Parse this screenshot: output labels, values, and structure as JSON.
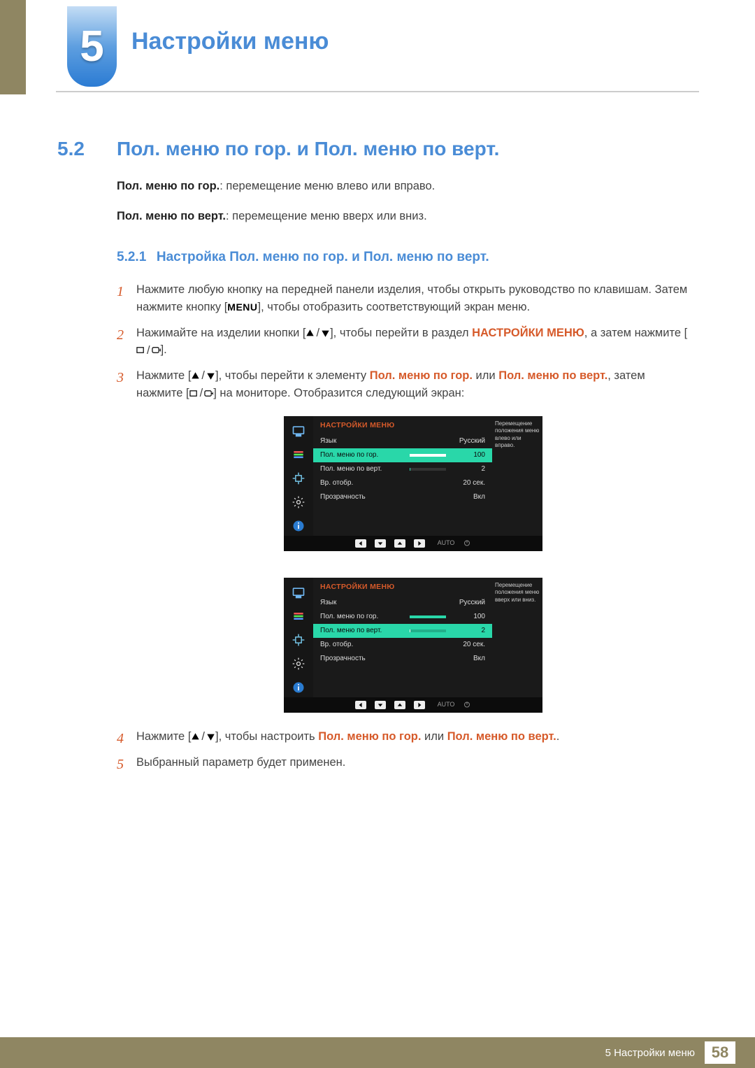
{
  "chapter": {
    "number": "5",
    "title": "Настройки меню"
  },
  "section": {
    "number": "5.2",
    "title": "Пол. меню по гор. и Пол. меню по верт."
  },
  "intro": {
    "h_bold": "Пол. меню по гор.",
    "h_rest": ": перемещение меню влево или вправо.",
    "v_bold": "Пол. меню по верт.",
    "v_rest": ": перемещение меню вверх или вниз."
  },
  "subsection": {
    "number": "5.2.1",
    "title": "Настройка Пол. меню по гор. и Пол. меню по верт."
  },
  "steps": {
    "s1a": "Нажмите любую кнопку на передней панели изделия, чтобы открыть руководство по клавишам. Затем нажмите кнопку [",
    "s1_menu": "MENU",
    "s1b": "], чтобы отобразить соответствующий экран меню.",
    "s2a": "Нажимайте на изделии кнопки [",
    "s2b": "], чтобы перейти в раздел ",
    "s2_target": "НАСТРОЙКИ МЕНЮ",
    "s2c": ", а затем нажмите [",
    "s2d": "].",
    "s3a": "Нажмите [",
    "s3b": "], чтобы перейти к элементу ",
    "s3_h": "Пол. меню по гор.",
    "s3_or": " или ",
    "s3_v": "Пол. меню по верт.",
    "s3c": ", затем нажмите [",
    "s3d": "] на мониторе. Отобразится следующий экран:",
    "s4a": "Нажмите [",
    "s4b": "], чтобы настроить ",
    "s4_h": "Пол. меню по гор.",
    "s4_or": " или ",
    "s4_v": "Пол. меню по верт.",
    "s4c": ".",
    "s5": "Выбранный параметр будет применен."
  },
  "osd": {
    "title": "НАСТРОЙКИ МЕНЮ",
    "tip_h": "Перемещение положения меню влево или вправо.",
    "tip_v": "Перемещение положения меню вверх или вниз.",
    "rows": {
      "lang": {
        "label": "Язык",
        "value": "Русский"
      },
      "hpos": {
        "label": "Пол. меню по гор.",
        "value": "100",
        "pct": 100
      },
      "vpos": {
        "label": "Пол. меню по верт.",
        "value": "2",
        "pct": 2
      },
      "time": {
        "label": "Вр. отобр.",
        "value": "20 сек."
      },
      "transp": {
        "label": "Прозрачность",
        "value": "Вкл"
      }
    },
    "nav": {
      "auto": "AUTO"
    }
  },
  "footer": {
    "text": "5 Настройки меню",
    "page": "58"
  }
}
